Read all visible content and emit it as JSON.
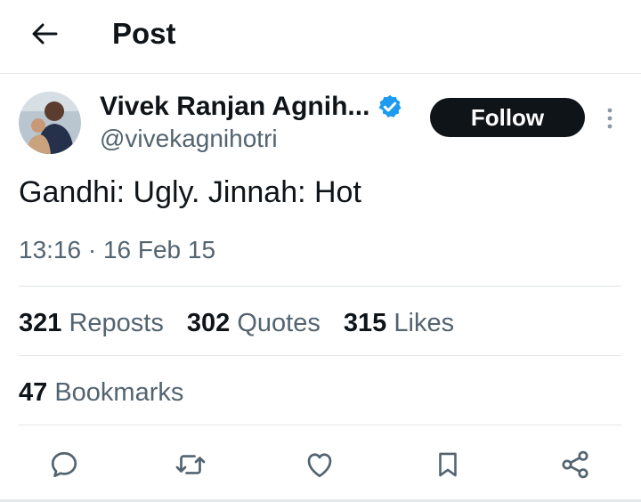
{
  "header": {
    "title": "Post"
  },
  "author": {
    "name": "Vivek Ranjan Agnih...",
    "handle": "@vivekagnihotri",
    "follow_label": "Follow",
    "verified_color": "#1d9bf0"
  },
  "post": {
    "text": "Gandhi: Ugly. Jinnah: Hot",
    "timestamp": "13:16 · 16 Feb 15"
  },
  "stats": {
    "reposts": {
      "count": "321",
      "label": "Reposts"
    },
    "quotes": {
      "count": "302",
      "label": "Quotes"
    },
    "likes": {
      "count": "315",
      "label": "Likes"
    },
    "bookmarks": {
      "count": "47",
      "label": "Bookmarks"
    }
  },
  "actions": [
    "reply-icon",
    "repost-icon",
    "like-icon",
    "bookmark-icon",
    "share-icon"
  ],
  "colors": {
    "text": "#0f1419",
    "secondary": "#536471",
    "button": "#0f1419"
  }
}
